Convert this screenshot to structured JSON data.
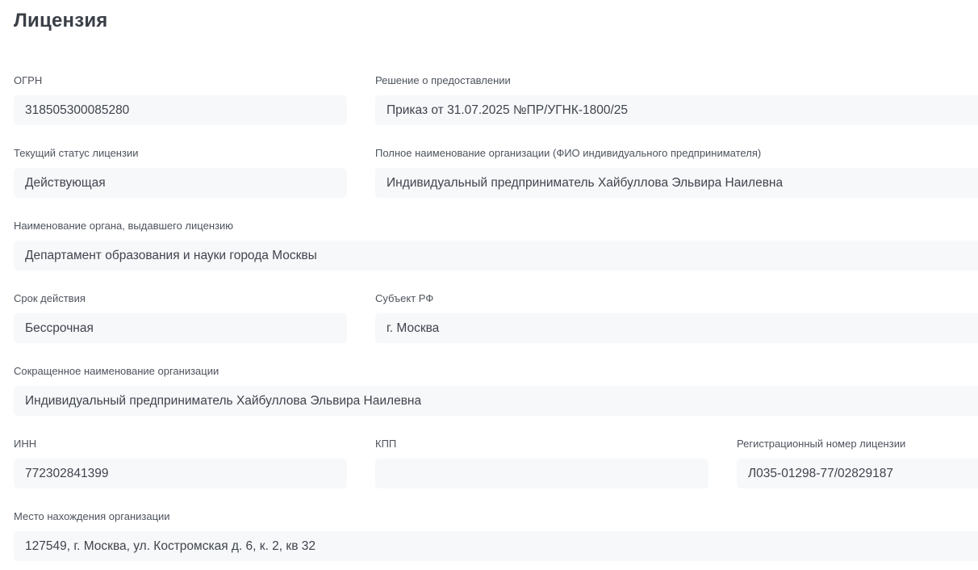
{
  "title": "Лицензия",
  "fields": {
    "ogrn": {
      "label": "ОГРН",
      "value": "318505300085280"
    },
    "decision": {
      "label": "Решение о предоставлении",
      "value": "Приказ от 31.07.2025 №ПР/УГНК-1800/25"
    },
    "status": {
      "label": "Текущий статус лицензии",
      "value": "Действующая"
    },
    "full_name": {
      "label": "Полное наименование организации (ФИО индивидуального предпринимателя)",
      "value": "Индивидуальный предприниматель Хайбуллова Эльвира Наилевна"
    },
    "issuer": {
      "label": "Наименование органа, выдавшего лицензию",
      "value": "Департамент образования и науки города Москвы"
    },
    "validity": {
      "label": "Срок действия",
      "value": "Бессрочная"
    },
    "region": {
      "label": "Субъект РФ",
      "value": "г. Москва"
    },
    "short_name": {
      "label": "Сокращенное наименование организации",
      "value": "Индивидуальный предприниматель Хайбуллова Эльвира Наилевна"
    },
    "inn": {
      "label": "ИНН",
      "value": "772302841399"
    },
    "kpp": {
      "label": "КПП",
      "value": ""
    },
    "reg_number": {
      "label": "Регистрационный номер лицензии",
      "value": "Л035-01298-77/02829187"
    },
    "address": {
      "label": "Место нахождения организации",
      "value": "127549, г. Москва, ул. Костромская д. 6, к. 2, кв 32"
    }
  }
}
